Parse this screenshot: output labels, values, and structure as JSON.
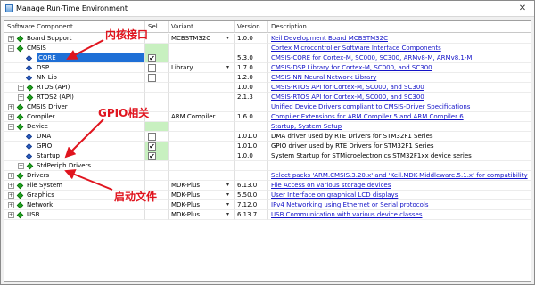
{
  "window": {
    "title": "Manage Run-Time Environment",
    "close_icon": "✕"
  },
  "columns": {
    "name": "Software Component",
    "sel": "Sel.",
    "variant": "Variant",
    "version": "Version",
    "description": "Description"
  },
  "rows": [
    {
      "name": "Board Support",
      "level": 0,
      "expand": "+",
      "icon": "gem",
      "sel": "",
      "sel_green": false,
      "variant": "MCBSTM32C",
      "variant_dd": true,
      "version": "1.0.0",
      "desc": "Keil Development Board MCBSTM32C",
      "link": true
    },
    {
      "name": "CMSIS",
      "level": 0,
      "expand": "−",
      "icon": "gem",
      "sel": "",
      "sel_green": true,
      "variant": "",
      "variant_dd": false,
      "version": "",
      "desc": "Cortex Microcontroller Software Interface Components",
      "link": true
    },
    {
      "name": "CORE",
      "level": 1,
      "expand": "",
      "icon": "blue",
      "sel": "✔",
      "sel_green": true,
      "variant": "",
      "variant_dd": false,
      "version": "5.3.0",
      "desc": "CMSIS-CORE for Cortex-M, SC000, SC300, ARMv8-M, ARMv8.1-M",
      "link": true,
      "highlight": true
    },
    {
      "name": "DSP",
      "level": 1,
      "expand": "",
      "icon": "blue",
      "sel": "☐",
      "sel_green": false,
      "variant": "Library",
      "variant_dd": true,
      "version": "1.7.0",
      "desc": "CMSIS-DSP Library for Cortex-M, SC000, and SC300",
      "link": true
    },
    {
      "name": "NN Lib",
      "level": 1,
      "expand": "",
      "icon": "blue",
      "sel": "☐",
      "sel_green": false,
      "variant": "",
      "variant_dd": false,
      "version": "1.2.0",
      "desc": "CMSIS-NN Neural Network Library",
      "link": true
    },
    {
      "name": "RTOS (API)",
      "level": 1,
      "expand": "+",
      "icon": "gem",
      "sel": "",
      "sel_green": false,
      "variant": "",
      "variant_dd": false,
      "version": "1.0.0",
      "desc": "CMSIS-RTOS API for Cortex-M, SC000, and SC300",
      "link": true
    },
    {
      "name": "RTOS2 (API)",
      "level": 1,
      "expand": "+",
      "icon": "gem",
      "sel": "",
      "sel_green": false,
      "variant": "",
      "variant_dd": false,
      "version": "2.1.3",
      "desc": "CMSIS-RTOS API for Cortex-M, SC000, and SC300",
      "link": true
    },
    {
      "name": "CMSIS Driver",
      "level": 0,
      "expand": "+",
      "icon": "gem",
      "sel": "",
      "sel_green": false,
      "variant": "",
      "variant_dd": false,
      "version": "",
      "desc": "Unified Device Drivers compliant to CMSIS-Driver Specifications",
      "link": true
    },
    {
      "name": "Compiler",
      "level": 0,
      "expand": "+",
      "icon": "gem",
      "sel": "",
      "sel_green": false,
      "variant": "ARM Compiler",
      "variant_dd": false,
      "version": "1.6.0",
      "desc": "Compiler Extensions for ARM Compiler 5 and ARM Compiler 6",
      "link": true
    },
    {
      "name": "Device",
      "level": 0,
      "expand": "−",
      "icon": "gem",
      "sel": "",
      "sel_green": true,
      "variant": "",
      "variant_dd": false,
      "version": "",
      "desc": "Startup, System Setup",
      "link": true
    },
    {
      "name": "DMA",
      "level": 1,
      "expand": "",
      "icon": "blue",
      "sel": "☐",
      "sel_green": false,
      "variant": "",
      "variant_dd": false,
      "version": "1.01.0",
      "desc": "DMA driver used by RTE Drivers for STM32F1 Series",
      "link": false
    },
    {
      "name": "GPIO",
      "level": 1,
      "expand": "",
      "icon": "blue",
      "sel": "✔",
      "sel_green": true,
      "variant": "",
      "variant_dd": false,
      "version": "1.01.0",
      "desc": "GPIO driver used by RTE Drivers for STM32F1 Series",
      "link": false
    },
    {
      "name": "Startup",
      "level": 1,
      "expand": "",
      "icon": "blue",
      "sel": "✔",
      "sel_green": true,
      "variant": "",
      "variant_dd": false,
      "version": "1.0.0",
      "desc": "System Startup for STMicroelectronics STM32F1xx device series",
      "link": false
    },
    {
      "name": "StdPeriph Drivers",
      "level": 1,
      "expand": "+",
      "icon": "gem",
      "sel": "",
      "sel_green": false,
      "variant": "",
      "variant_dd": false,
      "version": "",
      "desc": "",
      "link": false
    },
    {
      "name": "Drivers",
      "level": 0,
      "expand": "+",
      "icon": "gem",
      "sel": "",
      "sel_green": false,
      "variant": "",
      "variant_dd": false,
      "version": "",
      "desc": "Select packs 'ARM.CMSIS.3.20.x' and 'Keil.MDK-Middleware.5.1.x' for compatibility",
      "link": true
    },
    {
      "name": "File System",
      "level": 0,
      "expand": "+",
      "icon": "gem",
      "sel": "",
      "sel_green": false,
      "variant": "MDK-Plus",
      "variant_dd": true,
      "version": "6.13.0",
      "desc": "File Access on various storage devices",
      "link": true
    },
    {
      "name": "Graphics",
      "level": 0,
      "expand": "+",
      "icon": "gem",
      "sel": "",
      "sel_green": false,
      "variant": "MDK-Plus",
      "variant_dd": true,
      "version": "5.50.0",
      "desc": "User Interface on graphical LCD displays",
      "link": true
    },
    {
      "name": "Network",
      "level": 0,
      "expand": "+",
      "icon": "gem",
      "sel": "",
      "sel_green": false,
      "variant": "MDK-Plus",
      "variant_dd": true,
      "version": "7.12.0",
      "desc": "IPv4 Networking using Ethernet or Serial protocols",
      "link": true
    },
    {
      "name": "USB",
      "level": 0,
      "expand": "+",
      "icon": "gem",
      "sel": "",
      "sel_green": false,
      "variant": "MDK-Plus",
      "variant_dd": true,
      "version": "6.13.7",
      "desc": "USB Communication with various device classes",
      "link": true
    }
  ],
  "annotations": {
    "core": "内核接口",
    "gpio": "GPIO相关",
    "startup": "启动文件"
  },
  "colors": {
    "highlight": "#1e6fd6",
    "link": "#1414c8",
    "annotation": "#e0141e",
    "sel_green": "#c8f0c0"
  }
}
